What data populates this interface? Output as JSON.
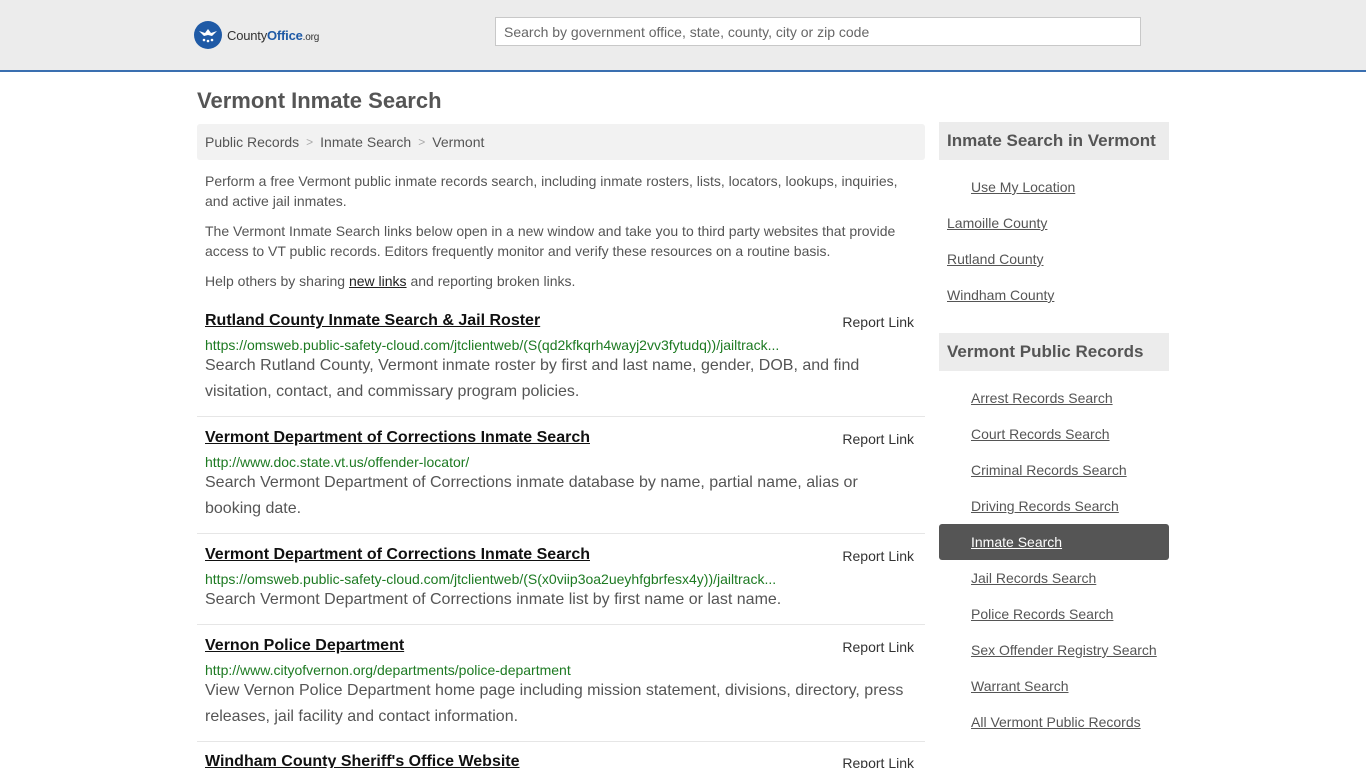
{
  "header": {
    "logo_main": "County",
    "logo_bold": "Office",
    "logo_tld": ".org",
    "search_placeholder": "Search by government office, state, county, city or zip code"
  },
  "page_title": "Vermont Inmate Search",
  "breadcrumb": [
    "Public Records",
    "Inmate Search",
    "Vermont"
  ],
  "intro": {
    "p1": "Perform a free Vermont public inmate records search, including inmate rosters, lists, locators, lookups, inquiries, and active jail inmates.",
    "p2": "The Vermont Inmate Search links below open in a new window and take you to third party websites that provide access to VT public records. Editors frequently monitor and verify these resources on a routine basis.",
    "p3_before": "Help others by sharing ",
    "p3_link": "new links",
    "p3_after": " and reporting broken links."
  },
  "report_label": "Report Link",
  "results": [
    {
      "title": "Rutland County Inmate Search & Jail Roster",
      "url": "https://omsweb.public-safety-cloud.com/jtclientweb/(S(qd2kfkqrh4wayj2vv3fytudq))/jailtrack...",
      "desc": "Search Rutland County, Vermont inmate roster by first and last name, gender, DOB, and find visitation, contact, and commissary program policies."
    },
    {
      "title": "Vermont Department of Corrections Inmate Search",
      "url": "http://www.doc.state.vt.us/offender-locator/",
      "desc": "Search Vermont Department of Corrections inmate database by name, partial name, alias or booking date."
    },
    {
      "title": "Vermont Department of Corrections Inmate Search",
      "url": "https://omsweb.public-safety-cloud.com/jtclientweb/(S(x0viip3oa2ueyhfgbrfesx4y))/jailtrack...",
      "desc": "Search Vermont Department of Corrections inmate list by first name or last name."
    },
    {
      "title": "Vernon Police Department",
      "url": "http://www.cityofvernon.org/departments/police-department",
      "desc": "View Vernon Police Department home page including mission statement, divisions, directory, press releases, jail facility and contact information."
    },
    {
      "title": "Windham County Sheriff's Office Website",
      "url": "",
      "desc": ""
    }
  ],
  "sidebar": {
    "section1": {
      "heading": "Inmate Search in Vermont",
      "use_location": "Use My Location",
      "counties": [
        "Lamoille County",
        "Rutland County",
        "Windham County"
      ]
    },
    "section2": {
      "heading": "Vermont Public Records",
      "links": [
        "Arrest Records Search",
        "Court Records Search",
        "Criminal Records Search",
        "Driving Records Search",
        "Inmate Search",
        "Jail Records Search",
        "Police Records Search",
        "Sex Offender Registry Search",
        "Warrant Search",
        "All Vermont Public Records"
      ],
      "active_index": 4
    }
  },
  "colors": {
    "brand": "#1f5aa6",
    "url_green": "#1d7a22",
    "active_bg": "#555555"
  }
}
